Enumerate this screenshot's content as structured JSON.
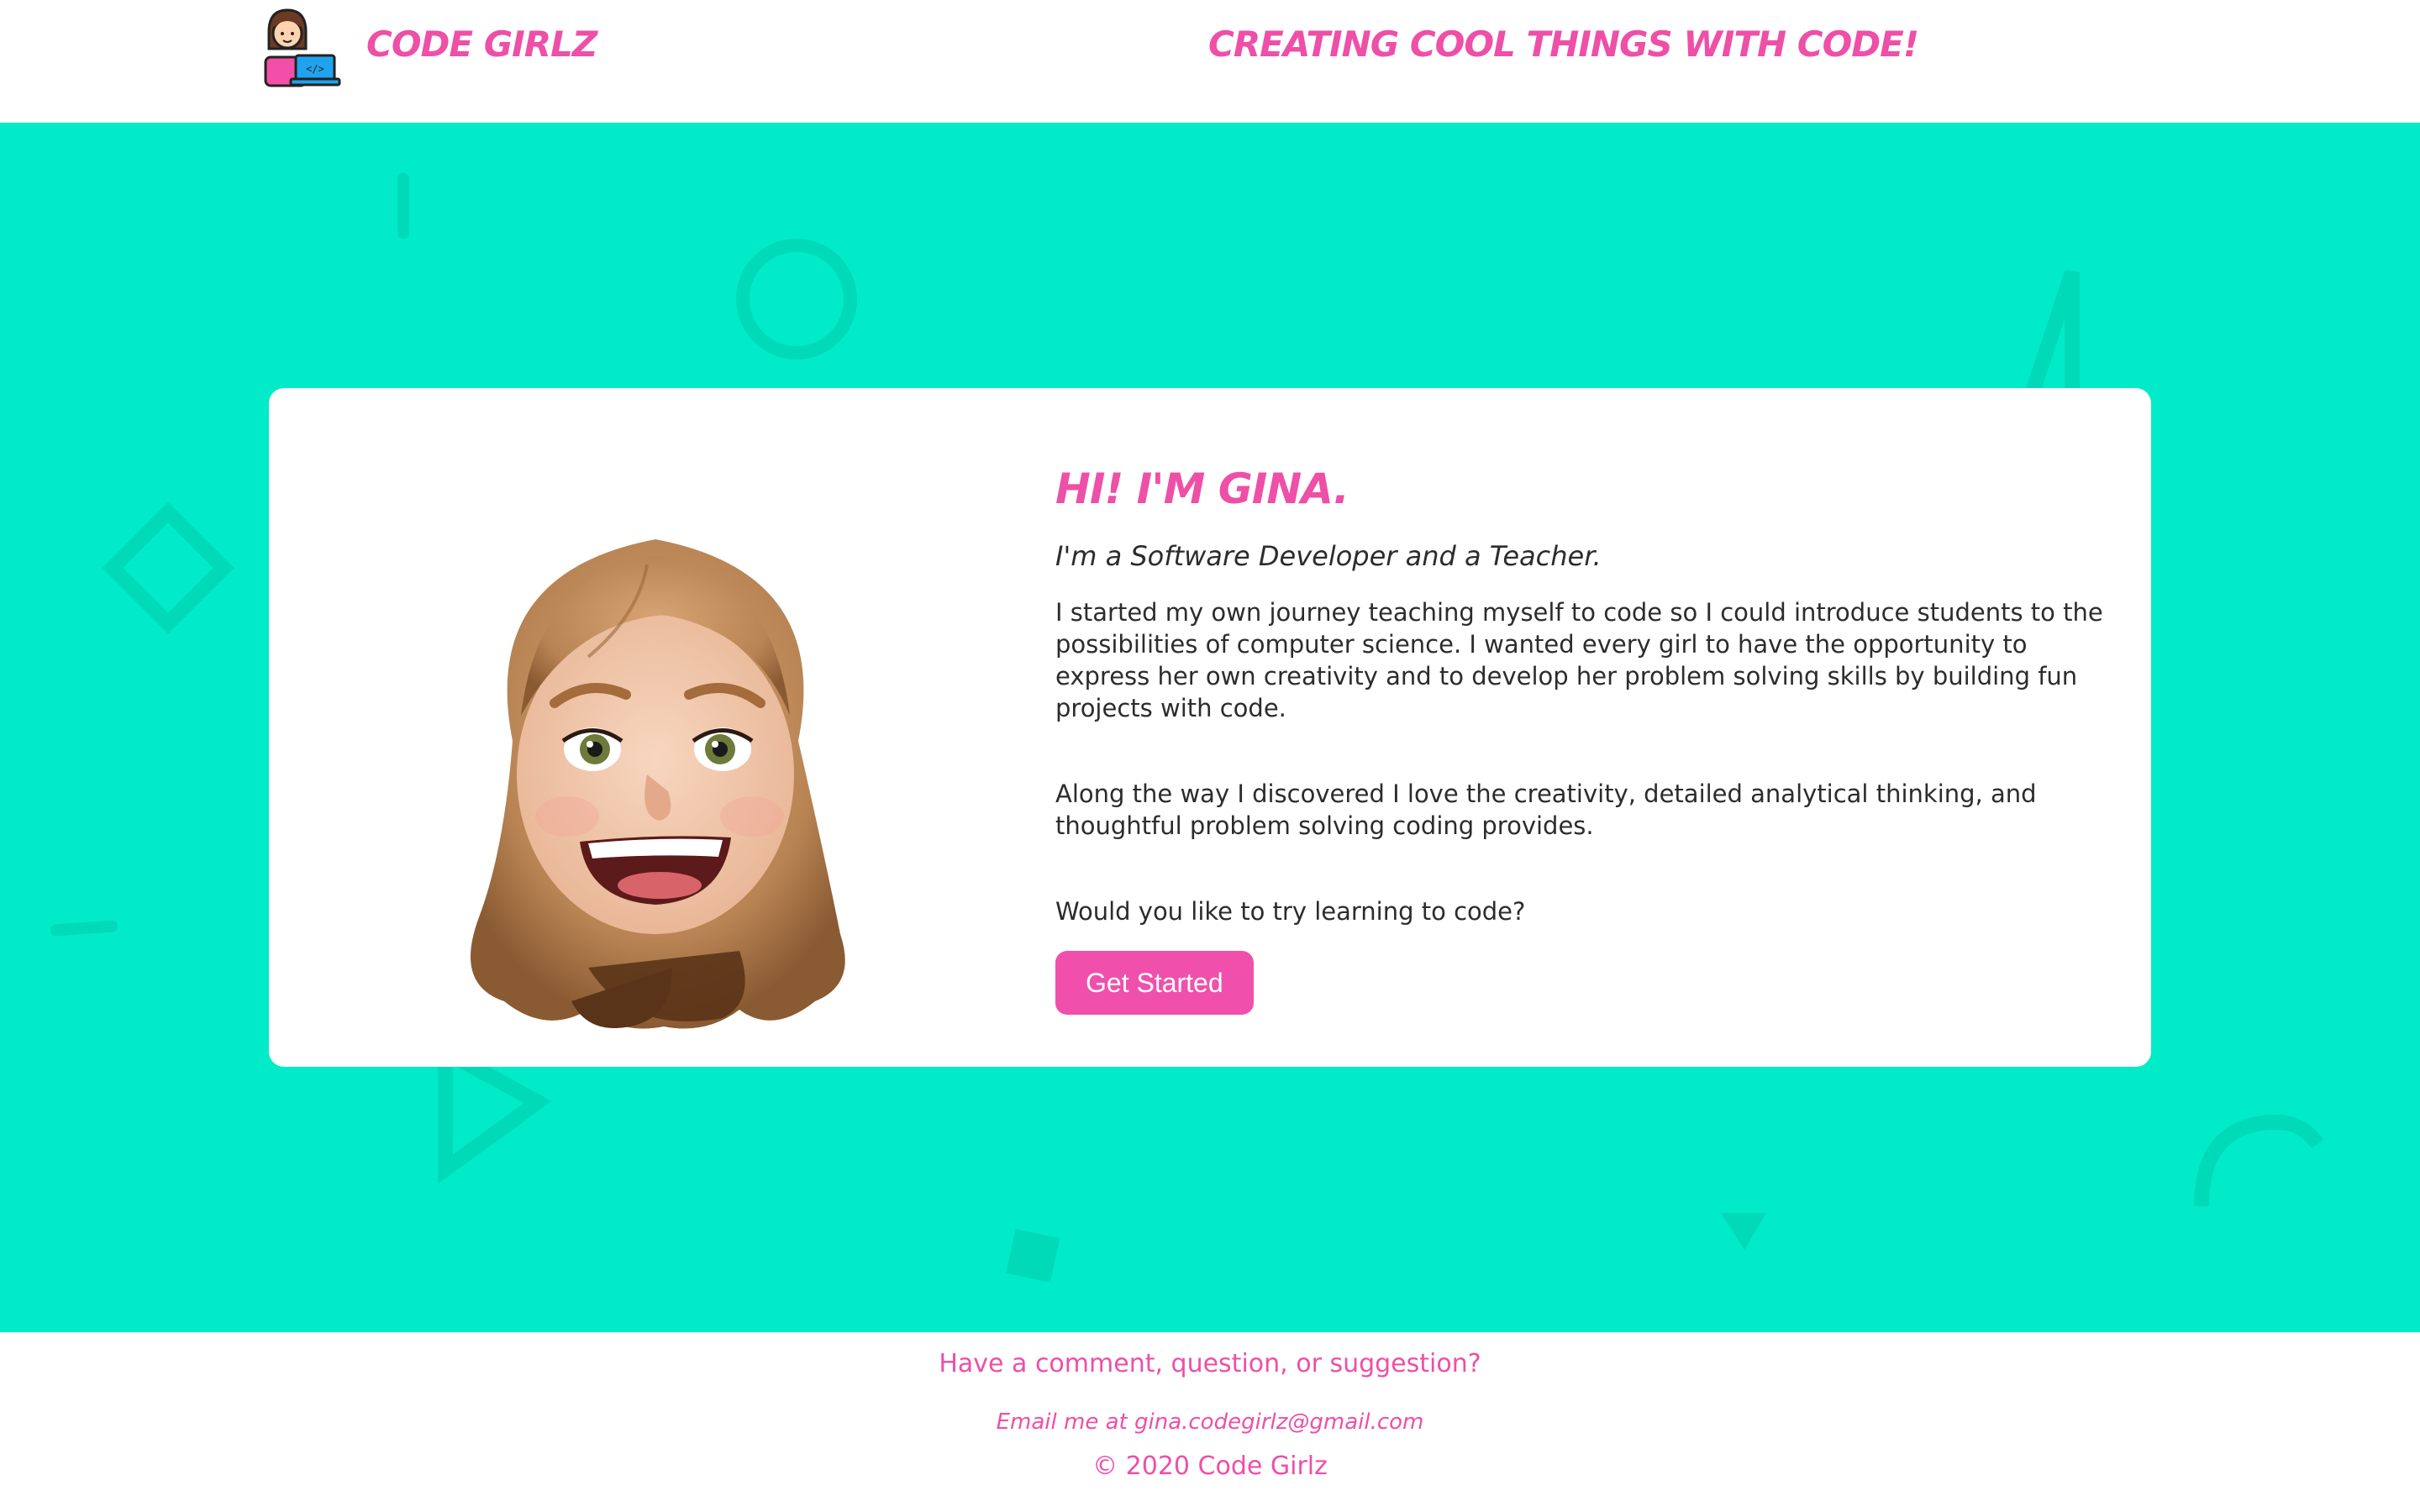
{
  "header": {
    "brand": "Code Girlz",
    "tagline": "Creating Cool Things With Code!",
    "logo_icon": "girl-with-laptop-icon"
  },
  "hero": {
    "background_color": "#02ebc8"
  },
  "intro": {
    "heading": "Hi! I'm Gina.",
    "subtitle": "I'm a Software Developer and a Teacher.",
    "paragraph_1": "I started my own journey teaching myself to code so I could introduce students to the possibilities of computer science. I wanted every girl to have the opportunity to express her own creativity and to develop her problem solving skills by building fun projects with code.",
    "paragraph_2": "Along the way I discovered I love the creativity, detailed analytical thinking, and thoughtful problem solving coding provides.",
    "paragraph_3": "Would you like to try learning to code?",
    "cta_label": "Get Started",
    "avatar_icon": "memoji-avatar"
  },
  "footer": {
    "question": "Have a comment, question, or suggestion?",
    "email_text": "Email me at gina.codegirlz@gmail.com",
    "copyright": "© 2020 Code Girlz"
  },
  "colors": {
    "accent": "#ee4fa7",
    "button": "#f050ab",
    "hero": "#02ebc8",
    "text": "#2c2c2c"
  }
}
